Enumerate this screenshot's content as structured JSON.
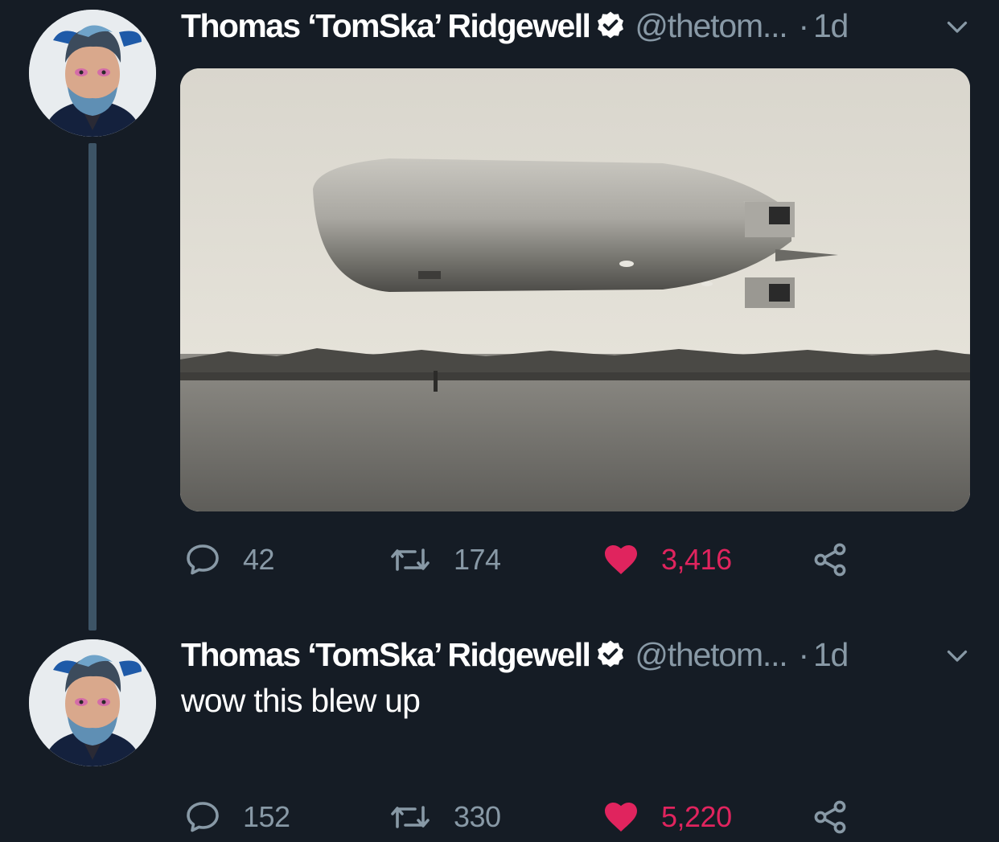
{
  "colors": {
    "background": "#151c25",
    "secondary_text": "#8899a6",
    "like": "#e0245e",
    "thread_line": "#3d5466"
  },
  "tweets": [
    {
      "author_name": "Thomas ‘TomSka’ Ridgewell",
      "verified": true,
      "handle": "@thetom...",
      "dot": "·",
      "time": "1d",
      "text": "",
      "media": "photo of a zeppelin airship flying low over a field with a crowd",
      "stats": {
        "replies": "42",
        "retweets": "174",
        "likes": "3,416",
        "liked": true
      }
    },
    {
      "author_name": "Thomas ‘TomSka’ Ridgewell",
      "verified": true,
      "handle": "@thetom...",
      "dot": "·",
      "time": "1d",
      "text": "wow this blew up",
      "stats": {
        "replies": "152",
        "retweets": "330",
        "likes": "5,220",
        "liked": true
      }
    }
  ],
  "icons": {
    "reply": "reply-icon",
    "retweet": "retweet-icon",
    "like": "heart-icon",
    "share": "share-icon",
    "verified": "verified-badge-icon",
    "menu": "chevron-down-icon"
  }
}
